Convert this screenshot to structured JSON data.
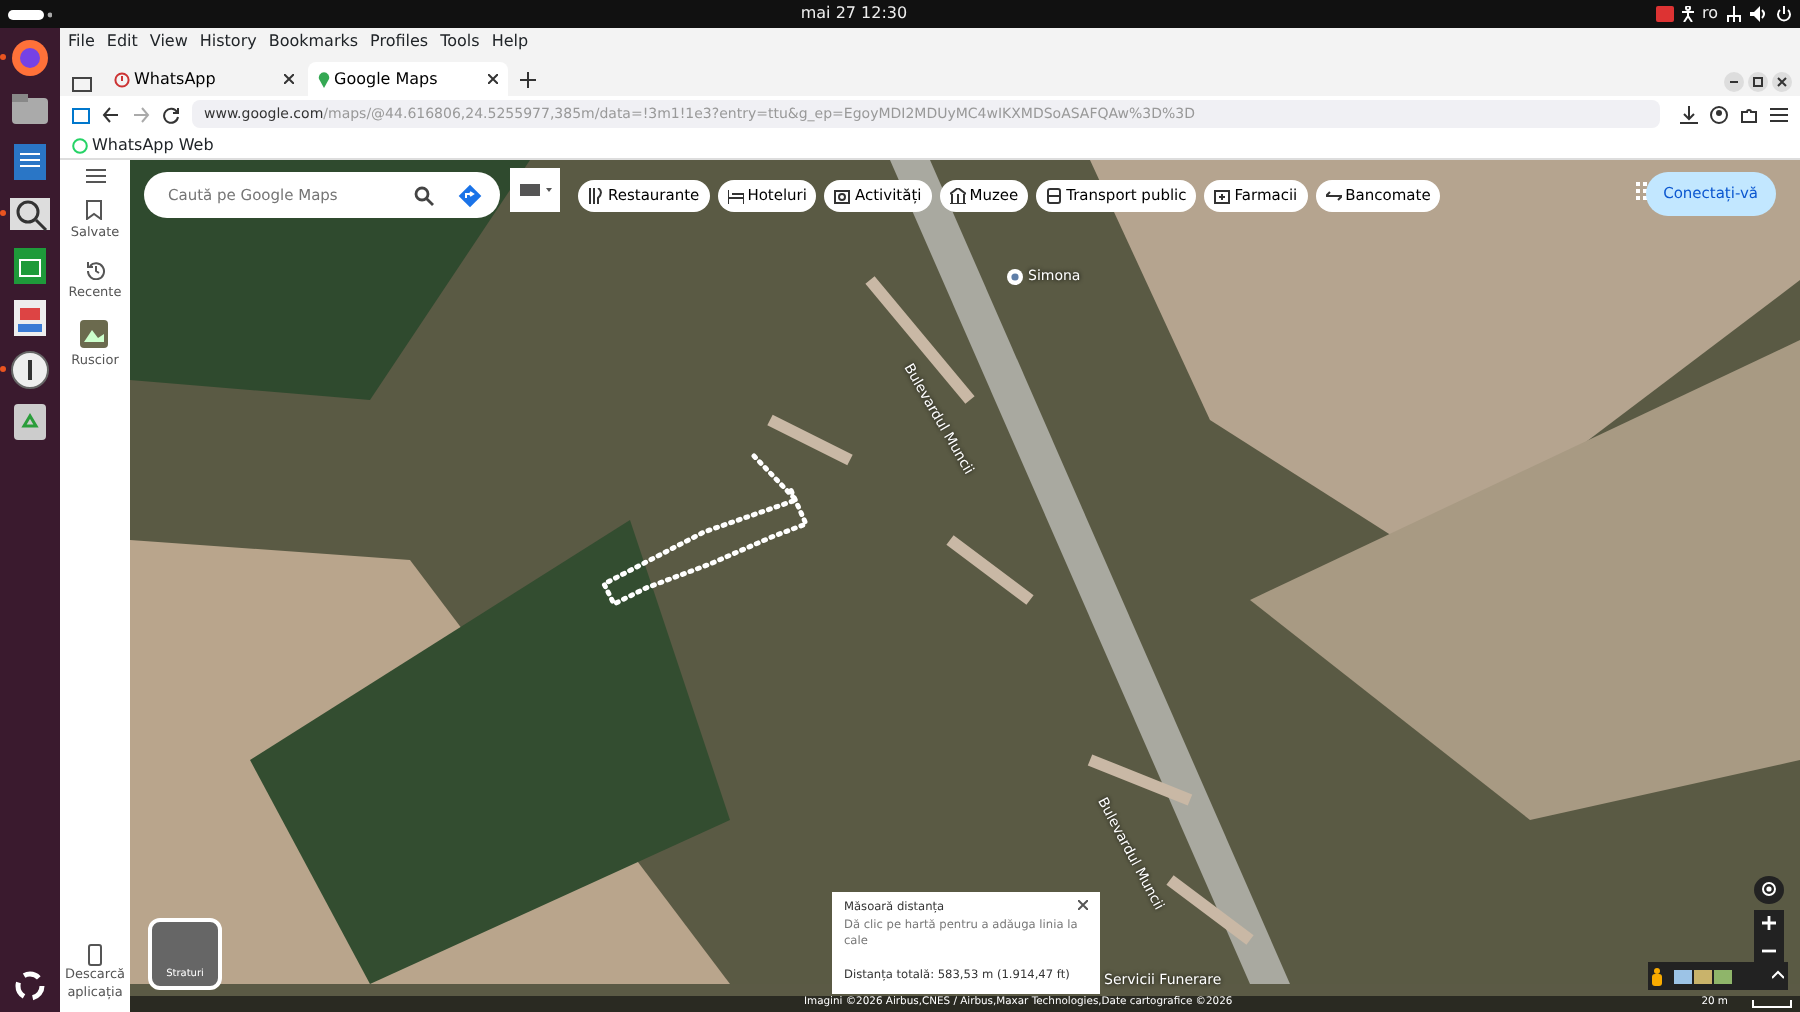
{
  "top_bar": {
    "clock": "mai 27  12:30",
    "language": "ro"
  },
  "dock": {
    "apps": [
      {
        "kind": "firefox",
        "selected": true
      },
      {
        "kind": "files",
        "selected": false
      },
      {
        "kind": "writer",
        "selected": false
      },
      {
        "kind": "search",
        "selected": true
      },
      {
        "kind": "calc",
        "selected": false
      },
      {
        "kind": "impress",
        "selected": false
      },
      {
        "kind": "info",
        "selected": true
      },
      {
        "kind": "trash",
        "selected": false
      }
    ]
  },
  "menu_bar": [
    "File",
    "Edit",
    "View",
    "History",
    "Bookmarks",
    "Profiles",
    "Tools",
    "Help"
  ],
  "tabs": [
    {
      "label": "WhatsApp",
      "kind": "whatsapp",
      "selected": false
    },
    {
      "label": "Google Maps",
      "kind": "maps",
      "selected": true
    }
  ],
  "address_bar": {
    "host": "www.google.com",
    "path": "/maps/@44.616806,24.5255977,385m/data=!3m1!1e3?entry=ttu&g_ep=EgoyMDI2MDUyMC4wIKXMDSoASAFQAw%3D%3D"
  },
  "bookmarks": [
    "WhatsApp Web"
  ],
  "maps_sidebar": {
    "items": [
      {
        "kind": "saved",
        "label": "Salvate"
      },
      {
        "kind": "recent",
        "label": "Recente"
      },
      {
        "kind": "place",
        "label": "Ruscior"
      }
    ],
    "download": "Descarcă aplicația"
  },
  "search": {
    "placeholder": "Caută pe Google Maps"
  },
  "chips": [
    {
      "kind": "food",
      "label": "Restaurante"
    },
    {
      "kind": "hotel",
      "label": "Hoteluri"
    },
    {
      "kind": "camera",
      "label": "Activități"
    },
    {
      "kind": "museum",
      "label": "Muzee"
    },
    {
      "kind": "bus",
      "label": "Transport public"
    },
    {
      "kind": "pharmacy",
      "label": "Farmacii"
    },
    {
      "kind": "atm",
      "label": "Bancomate"
    }
  ],
  "sign_in": "Conectați-vă",
  "map_labels": [
    {
      "kind": "place",
      "label": "Simona"
    },
    {
      "kind": "road",
      "label": "Bulevardul Muncii"
    },
    {
      "kind": "road",
      "label": "Bulevardul Muncii"
    },
    {
      "kind": "place",
      "label": "Servicii Funerare"
    }
  ],
  "layers_button": "Straturi",
  "measure": {
    "title": "Măsoară distanța",
    "hint": "Dă clic pe hartă pentru a adăuga linia la cale",
    "total": "Distanța totală: 583,53 m (1.914,47 ft)"
  },
  "attribution": {
    "imagery": "Imagini ©2026 Airbus,CNES / Airbus,Maxar Technologies,Date cartografice ©2026",
    "scale": "20 m"
  }
}
